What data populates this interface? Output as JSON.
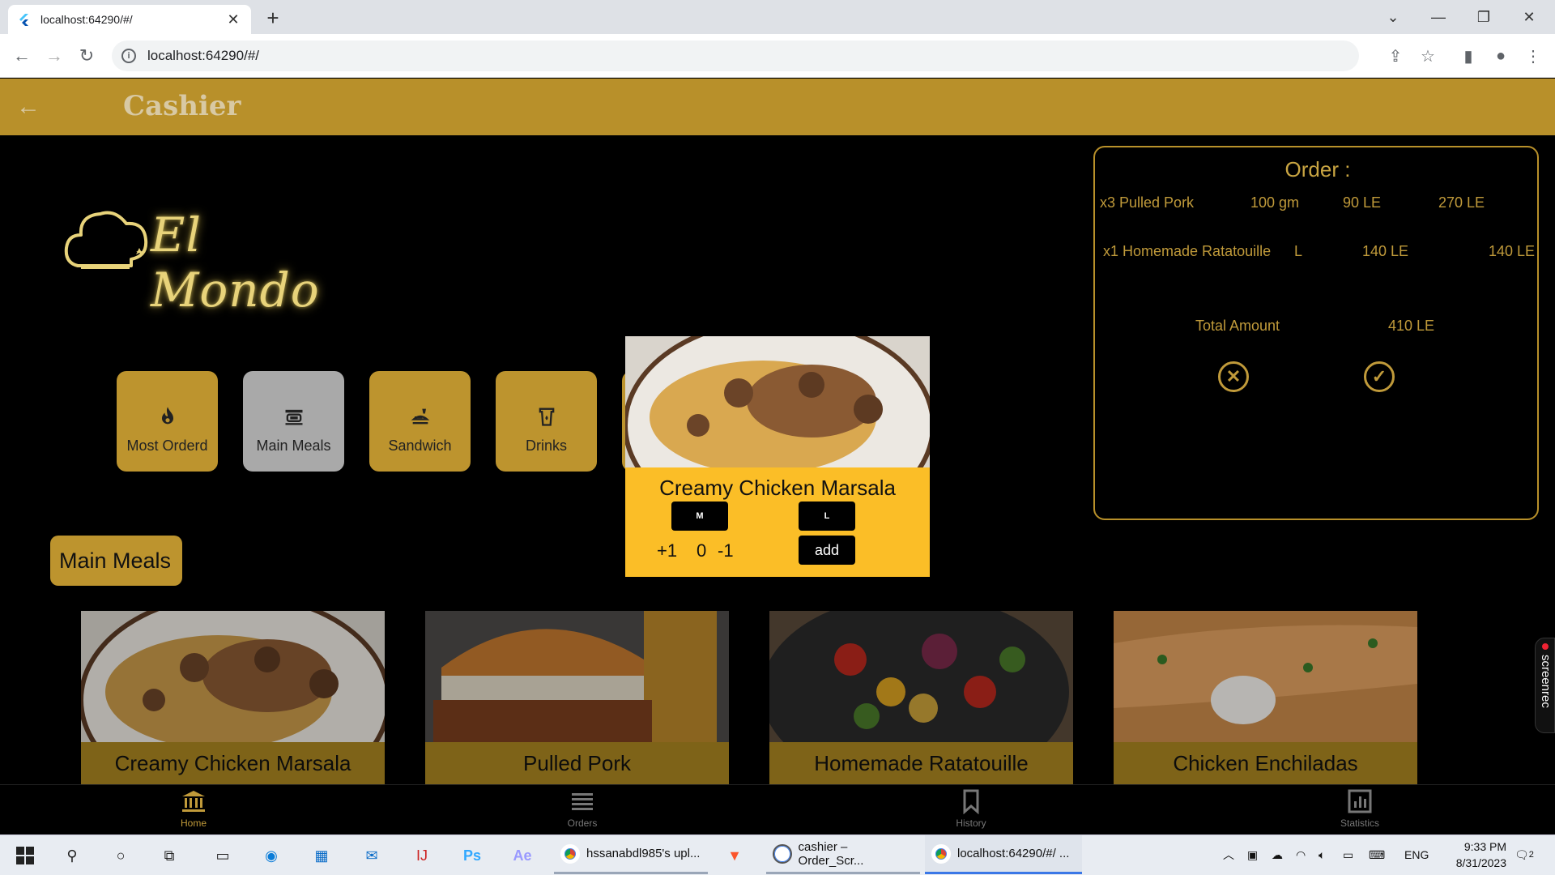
{
  "browser": {
    "tab_title": "localhost:64290/#/",
    "url": "localhost:64290/#/"
  },
  "app": {
    "title": "Cashier",
    "logo_text": "El Mondo",
    "accent": "#b8902a",
    "popup_color": "#fbbe27"
  },
  "categories": [
    {
      "label": "Most Orderd",
      "icon": "flame-icon"
    },
    {
      "label": "Main Meals",
      "icon": "dish-icon",
      "selected": true
    },
    {
      "label": "Sandwich",
      "icon": "sandwich-icon"
    },
    {
      "label": "Drinks",
      "icon": "cup-icon"
    }
  ],
  "section_title": "Main Meals",
  "meals": [
    {
      "name": "Creamy Chicken Marsala"
    },
    {
      "name": "Pulled Pork"
    },
    {
      "name": "Homemade Ratatouille"
    },
    {
      "name": "Chicken Enchiladas"
    }
  ],
  "order": {
    "title": "Order :",
    "items": [
      {
        "qty": "x3 Pulled Pork",
        "size": "100 gm",
        "price": "90 LE",
        "total": "270 LE"
      },
      {
        "qty": "x1 Homemade Ratatouille",
        "size": "L",
        "price": "140 LE",
        "total": "140 LE"
      }
    ],
    "total_label": "Total Amount",
    "total_value": "410 LE"
  },
  "popup": {
    "name": "Creamy Chicken Marsala",
    "size_m": "M",
    "size_l": "L",
    "plus": "+1",
    "count": "0",
    "minus": "-1",
    "add": "add"
  },
  "bottom_nav": [
    {
      "label": "Home",
      "icon": "home-bank-icon",
      "active": true
    },
    {
      "label": "Orders",
      "icon": "list-icon"
    },
    {
      "label": "History",
      "icon": "bookmark-icon"
    },
    {
      "label": "Statistics",
      "icon": "chart-icon"
    }
  ],
  "screenrec": "screenrec",
  "taskbar": {
    "apps": [
      {
        "label": "hssanabdl985's upl..."
      },
      {
        "label": "cashier – Order_Scr..."
      },
      {
        "label": "localhost:64290/#/ ..."
      }
    ],
    "lang": "ENG",
    "time": "9:33 PM",
    "date": "8/31/2023",
    "notif_count": "2"
  }
}
